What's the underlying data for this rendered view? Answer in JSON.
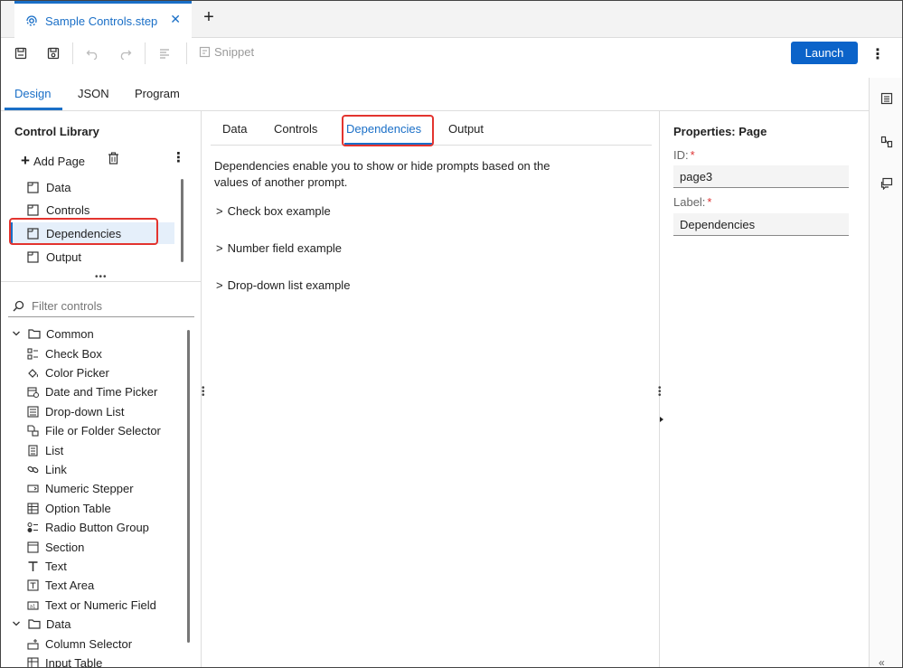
{
  "file_tab": {
    "label": "Sample Controls.step"
  },
  "toolbar": {
    "snippet_label": "Snippet",
    "launch_label": "Launch"
  },
  "top_tabs": [
    {
      "label": "Design",
      "active": true
    },
    {
      "label": "JSON",
      "active": false
    },
    {
      "label": "Program",
      "active": false
    }
  ],
  "library": {
    "title": "Control Library",
    "add_page_label": "Add Page",
    "pages": [
      {
        "label": "Data",
        "selected": false
      },
      {
        "label": "Controls",
        "selected": false
      },
      {
        "label": "Dependencies",
        "selected": true
      },
      {
        "label": "Output",
        "selected": false
      }
    ],
    "filter_placeholder": "Filter controls",
    "tree": {
      "common_label": "Common",
      "common_items": [
        {
          "label": "Check Box",
          "icon": "checkbox-list-icon"
        },
        {
          "label": "Color Picker",
          "icon": "paint-bucket-icon"
        },
        {
          "label": "Date and Time Picker",
          "icon": "calendar-clock-icon"
        },
        {
          "label": "Drop-down List",
          "icon": "dropdown-list-icon"
        },
        {
          "label": "File or Folder Selector",
          "icon": "file-folder-icon"
        },
        {
          "label": "List",
          "icon": "list-icon"
        },
        {
          "label": "Link",
          "icon": "link-icon"
        },
        {
          "label": "Numeric Stepper",
          "icon": "stepper-icon"
        },
        {
          "label": "Option Table",
          "icon": "table-icon"
        },
        {
          "label": "Radio Button Group",
          "icon": "radio-group-icon"
        },
        {
          "label": "Section",
          "icon": "section-icon"
        },
        {
          "label": "Text",
          "icon": "text-icon"
        },
        {
          "label": "Text Area",
          "icon": "text-area-icon"
        },
        {
          "label": "Text or Numeric Field",
          "icon": "text-field-icon"
        }
      ],
      "data_label": "Data",
      "data_items": [
        {
          "label": "Column Selector",
          "icon": "column-selector-icon"
        },
        {
          "label": "Input Table",
          "icon": "input-table-icon"
        }
      ]
    }
  },
  "center": {
    "tabs": [
      {
        "label": "Data",
        "active": false
      },
      {
        "label": "Controls",
        "active": false
      },
      {
        "label": "Dependencies",
        "active": true
      },
      {
        "label": "Output",
        "active": false
      }
    ],
    "description_line1": "Dependencies enable you to show or hide prompts based on the",
    "description_line2": "values of another prompt.",
    "expander_glyph": ">",
    "expanders": [
      {
        "label": "Check box example"
      },
      {
        "label": "Number field example"
      },
      {
        "label": "Drop-down list example"
      }
    ]
  },
  "properties": {
    "title": "Properties: Page",
    "id_label": "ID:",
    "id_value": "page3",
    "label_label": "Label:",
    "label_value": "Dependencies",
    "required_mark": "*"
  },
  "colors": {
    "accent": "#1a6fc7",
    "launch": "#0b63c9",
    "highlight": "#e3342f",
    "selected_bg": "#e5effa"
  }
}
